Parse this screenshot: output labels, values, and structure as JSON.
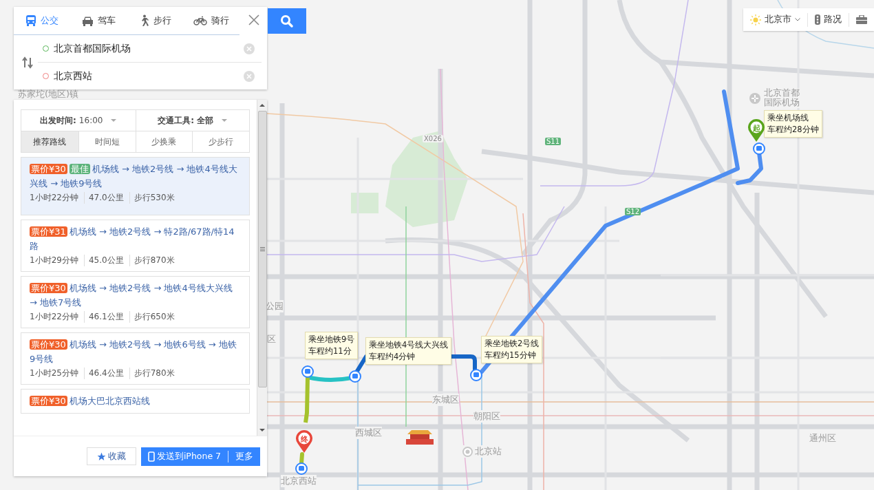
{
  "search": {
    "modes": [
      {
        "label": "公交",
        "kind": "bus",
        "selected": true
      },
      {
        "label": "驾车",
        "kind": "car",
        "selected": false
      },
      {
        "label": "步行",
        "kind": "walk",
        "selected": false
      },
      {
        "label": "骑行",
        "kind": "bike",
        "selected": false
      }
    ],
    "origin": "北京首都国际机场",
    "destination": "北京西站"
  },
  "filters": {
    "departure_label": "出发时间:",
    "departure_value": "16:00",
    "transport_label": "交通工具:",
    "transport_value": "全部"
  },
  "sort_tabs": [
    {
      "label": "推荐路线",
      "selected": true
    },
    {
      "label": "时间短",
      "selected": false
    },
    {
      "label": "少换乘",
      "selected": false
    },
    {
      "label": "少步行",
      "selected": false
    }
  ],
  "routes": [
    {
      "price": "票价¥30",
      "badge": "最佳",
      "path": "机场线 → 地铁2号线 → 地铁4号线大兴线 → 地铁9号线",
      "duration": "1小时22分钟",
      "distance": "47.0公里",
      "walk": "步行530米",
      "selected": true
    },
    {
      "price": "票价¥31",
      "path": "机场线 → 地铁2号线 → 特2路/67路/特14路",
      "duration": "1小时29分钟",
      "distance": "45.0公里",
      "walk": "步行870米",
      "selected": false
    },
    {
      "price": "票价¥30",
      "path": "机场线 → 地铁2号线 → 地铁4号线大兴线 → 地铁7号线",
      "duration": "1小时22分钟",
      "distance": "46.1公里",
      "walk": "步行650米",
      "selected": false
    },
    {
      "price": "票价¥30",
      "path": "机场线 → 地铁2号线 → 地铁6号线 → 地铁9号线",
      "duration": "1小时25分钟",
      "distance": "46.4公里",
      "walk": "步行780米",
      "selected": false
    },
    {
      "price": "票价¥30",
      "path": "机场大巴北京西站线",
      "selected": false
    }
  ],
  "footer": {
    "favorite": "收藏",
    "send": "发送到iPhone 7",
    "more": "更多"
  },
  "top_right": {
    "city": "北京市",
    "traffic": "路况"
  },
  "map": {
    "labels": [
      {
        "text": "苏家坨(地区)镇",
        "kind": "area"
      },
      {
        "text": "北京首都国际机场",
        "kind": "airport"
      },
      {
        "text": "公园",
        "kind": "area"
      },
      {
        "text": "区",
        "kind": "area"
      },
      {
        "text": "东城区",
        "kind": "area"
      },
      {
        "text": "西城区",
        "kind": "area"
      },
      {
        "text": "朝阳区",
        "kind": "area"
      },
      {
        "text": "北京站",
        "kind": "station"
      },
      {
        "text": "北京西站",
        "kind": "area"
      },
      {
        "text": "通州区",
        "kind": "area"
      }
    ],
    "road_shields": [
      "X026",
      "S11",
      "S12"
    ],
    "tooltips": [
      {
        "lines": [
          "乘坐机场线",
          "车程约28分钟"
        ]
      },
      {
        "lines": [
          "乘坐地铁9号",
          "车程约11分"
        ]
      },
      {
        "lines": [
          "乘坐地铁4号线大兴线",
          "车程约4分钟"
        ]
      },
      {
        "lines": [
          "乘坐地铁2号线",
          "车程约15分钟"
        ]
      }
    ],
    "pins": [
      {
        "text": "起",
        "color": "#5aa51c"
      },
      {
        "text": "终",
        "color": "#e8473b"
      }
    ]
  }
}
